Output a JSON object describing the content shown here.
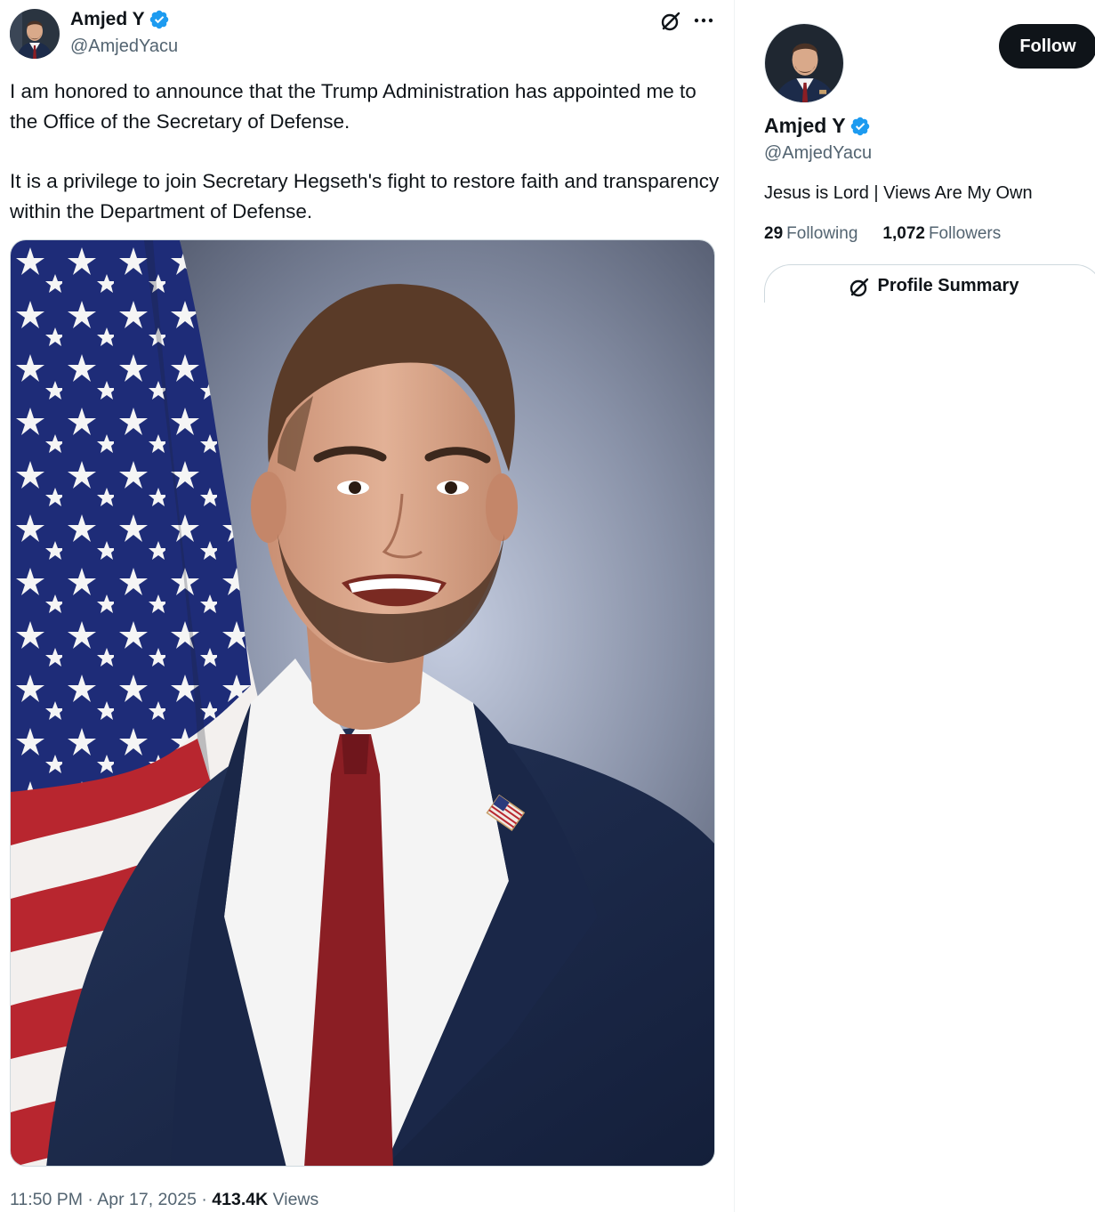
{
  "tweet": {
    "author_name": "Amjed Y",
    "author_handle": "@AmjedYacu",
    "verified": true,
    "paragraphs": [
      "I am honored to announce that the Trump Administration has appointed me to the Office of the Secretary of Defense.",
      "It is a privilege to join Secretary Hegseth's fight to restore faith and transparency within the Department of Defense."
    ],
    "timestamp": "11:50 PM · Apr 17, 2025 · ",
    "views_count": "413.4K",
    "views_label": " Views",
    "grok_icon": "grok-icon",
    "more_icon": "more-icon"
  },
  "profile_card": {
    "name": "Amjed Y",
    "handle": "@AmjedYacu",
    "follow_label": "Follow",
    "bio": "Jesus is Lord | Views Are My Own",
    "following_count": "29",
    "following_label": "Following",
    "followers_count": "1,072",
    "followers_label": "Followers",
    "summary_label": "Profile Summary"
  },
  "colors": {
    "verified_badge": "#1d9bf0",
    "follow_button_bg": "#0f1419",
    "muted_text": "#536471",
    "suit": "#1c2b4a",
    "tie": "#8b1e24"
  }
}
